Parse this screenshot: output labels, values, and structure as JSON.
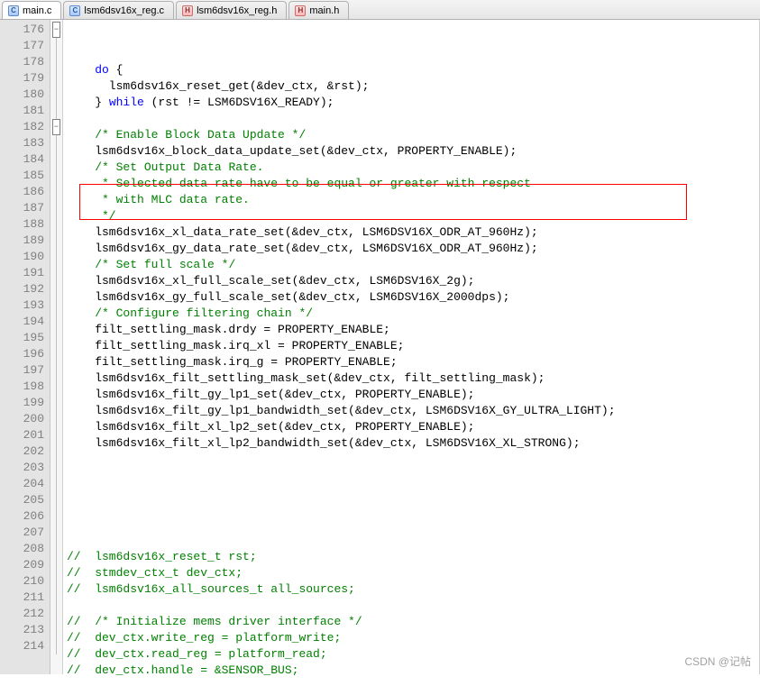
{
  "tabs": [
    {
      "label": "main.c",
      "icon": "c",
      "active": true
    },
    {
      "label": "lsm6dsv16x_reg.c",
      "icon": "c",
      "active": false
    },
    {
      "label": "lsm6dsv16x_reg.h",
      "icon": "h",
      "active": false
    },
    {
      "label": "main.h",
      "icon": "h",
      "active": false
    }
  ],
  "watermark": "CSDN @记帖",
  "lines": [
    {
      "n": 176,
      "fold": "box",
      "segs": [
        {
          "t": "    ",
          "c": "normal"
        },
        {
          "t": "do",
          "c": "kw"
        },
        {
          "t": " {",
          "c": "normal"
        }
      ]
    },
    {
      "n": 177,
      "fold": "line",
      "segs": [
        {
          "t": "      lsm6dsv16x_reset_get(&dev_ctx, &rst);",
          "c": "normal"
        }
      ]
    },
    {
      "n": 178,
      "fold": "line",
      "segs": [
        {
          "t": "    } ",
          "c": "normal"
        },
        {
          "t": "while",
          "c": "kw"
        },
        {
          "t": " (rst != LSM6DSV16X_READY);",
          "c": "normal"
        }
      ]
    },
    {
      "n": 179,
      "fold": "line",
      "segs": [
        {
          "t": "",
          "c": "normal"
        }
      ]
    },
    {
      "n": 180,
      "fold": "line",
      "segs": [
        {
          "t": "    ",
          "c": "normal"
        },
        {
          "t": "/* Enable Block Data Update */",
          "c": "comment"
        }
      ]
    },
    {
      "n": 181,
      "fold": "line",
      "segs": [
        {
          "t": "    lsm6dsv16x_block_data_update_set(&dev_ctx, PROPERTY_ENABLE);",
          "c": "normal"
        }
      ]
    },
    {
      "n": 182,
      "fold": "box",
      "segs": [
        {
          "t": "    ",
          "c": "normal"
        },
        {
          "t": "/* Set Output Data Rate.",
          "c": "comment"
        }
      ]
    },
    {
      "n": 183,
      "fold": "line",
      "segs": [
        {
          "t": "     * Selected data rate have to be equal or greater with respect",
          "c": "comment"
        }
      ]
    },
    {
      "n": 184,
      "fold": "line",
      "segs": [
        {
          "t": "     * with MLC data rate.",
          "c": "comment"
        }
      ]
    },
    {
      "n": 185,
      "fold": "line",
      "segs": [
        {
          "t": "     */",
          "c": "comment"
        }
      ]
    },
    {
      "n": 186,
      "fold": "line",
      "segs": [
        {
          "t": "    lsm6dsv16x_xl_data_rate_set(&dev_ctx, LSM6DSV16X_ODR_AT_960Hz);",
          "c": "normal"
        }
      ]
    },
    {
      "n": 187,
      "fold": "line",
      "segs": [
        {
          "t": "    lsm6dsv16x_gy_data_rate_set(&dev_ctx, LSM6DSV16X_ODR_AT_960Hz);",
          "c": "normal"
        }
      ]
    },
    {
      "n": 188,
      "fold": "line",
      "segs": [
        {
          "t": "    ",
          "c": "normal"
        },
        {
          "t": "/* Set full scale */",
          "c": "comment"
        }
      ]
    },
    {
      "n": 189,
      "fold": "line",
      "segs": [
        {
          "t": "    lsm6dsv16x_xl_full_scale_set(&dev_ctx, LSM6DSV16X_2g);",
          "c": "normal"
        }
      ]
    },
    {
      "n": 190,
      "fold": "line",
      "segs": [
        {
          "t": "    lsm6dsv16x_gy_full_scale_set(&dev_ctx, LSM6DSV16X_2000dps);",
          "c": "normal"
        }
      ]
    },
    {
      "n": 191,
      "fold": "line",
      "segs": [
        {
          "t": "    ",
          "c": "normal"
        },
        {
          "t": "/* Configure filtering chain */",
          "c": "comment"
        }
      ]
    },
    {
      "n": 192,
      "fold": "line",
      "segs": [
        {
          "t": "    filt_settling_mask.drdy = PROPERTY_ENABLE;",
          "c": "normal"
        }
      ]
    },
    {
      "n": 193,
      "fold": "line",
      "segs": [
        {
          "t": "    filt_settling_mask.irq_xl = PROPERTY_ENABLE;",
          "c": "normal"
        }
      ]
    },
    {
      "n": 194,
      "fold": "line",
      "segs": [
        {
          "t": "    filt_settling_mask.irq_g = PROPERTY_ENABLE;",
          "c": "normal"
        }
      ]
    },
    {
      "n": 195,
      "fold": "line",
      "segs": [
        {
          "t": "    lsm6dsv16x_filt_settling_mask_set(&dev_ctx, filt_settling_mask);",
          "c": "normal"
        }
      ]
    },
    {
      "n": 196,
      "fold": "line",
      "segs": [
        {
          "t": "    lsm6dsv16x_filt_gy_lp1_set(&dev_ctx, PROPERTY_ENABLE);",
          "c": "normal"
        }
      ]
    },
    {
      "n": 197,
      "fold": "line",
      "segs": [
        {
          "t": "    lsm6dsv16x_filt_gy_lp1_bandwidth_set(&dev_ctx, LSM6DSV16X_GY_ULTRA_LIGHT);",
          "c": "normal"
        }
      ]
    },
    {
      "n": 198,
      "fold": "line",
      "segs": [
        {
          "t": "    lsm6dsv16x_filt_xl_lp2_set(&dev_ctx, PROPERTY_ENABLE);",
          "c": "normal"
        }
      ]
    },
    {
      "n": 199,
      "fold": "line",
      "segs": [
        {
          "t": "    lsm6dsv16x_filt_xl_lp2_bandwidth_set(&dev_ctx, LSM6DSV16X_XL_STRONG);",
          "c": "normal"
        }
      ]
    },
    {
      "n": 200,
      "fold": "line",
      "segs": [
        {
          "t": "",
          "c": "normal"
        }
      ]
    },
    {
      "n": 201,
      "fold": "line",
      "segs": [
        {
          "t": "",
          "c": "normal"
        }
      ]
    },
    {
      "n": 202,
      "fold": "line",
      "segs": [
        {
          "t": "",
          "c": "normal"
        }
      ]
    },
    {
      "n": 203,
      "fold": "line",
      "segs": [
        {
          "t": "",
          "c": "normal"
        }
      ]
    },
    {
      "n": 204,
      "fold": "line",
      "segs": [
        {
          "t": "",
          "c": "normal"
        }
      ]
    },
    {
      "n": 205,
      "fold": "line",
      "segs": [
        {
          "t": "",
          "c": "normal"
        }
      ]
    },
    {
      "n": 206,
      "fold": "line",
      "segs": [
        {
          "t": "//  lsm6dsv16x_reset_t rst;",
          "c": "comment"
        }
      ]
    },
    {
      "n": 207,
      "fold": "line",
      "segs": [
        {
          "t": "//  stmdev_ctx_t dev_ctx;",
          "c": "comment"
        }
      ]
    },
    {
      "n": 208,
      "fold": "line",
      "segs": [
        {
          "t": "//  lsm6dsv16x_all_sources_t all_sources;",
          "c": "comment"
        }
      ]
    },
    {
      "n": 209,
      "fold": "line",
      "segs": [
        {
          "t": "",
          "c": "normal"
        }
      ]
    },
    {
      "n": 210,
      "fold": "line",
      "segs": [
        {
          "t": "//  /* Initialize mems driver interface */",
          "c": "comment"
        }
      ]
    },
    {
      "n": 211,
      "fold": "line",
      "segs": [
        {
          "t": "//  dev_ctx.write_reg = platform_write;",
          "c": "comment"
        }
      ]
    },
    {
      "n": 212,
      "fold": "line",
      "segs": [
        {
          "t": "//  dev_ctx.read_reg = platform_read;",
          "c": "comment"
        }
      ]
    },
    {
      "n": 213,
      "fold": "line",
      "segs": [
        {
          "t": "//  dev_ctx.handle = &SENSOR_BUS;",
          "c": "comment"
        }
      ]
    },
    {
      "n": 214,
      "fold": "line",
      "segs": [
        {
          "t": "",
          "c": "normal"
        }
      ]
    }
  ]
}
